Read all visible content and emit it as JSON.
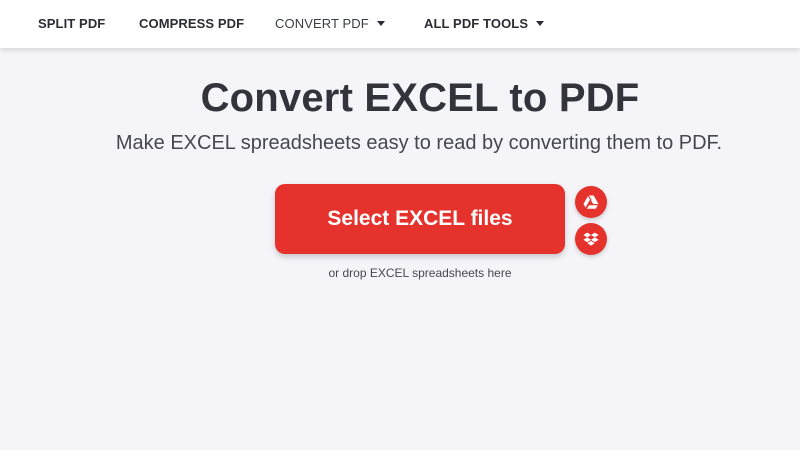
{
  "nav": {
    "items": [
      {
        "label": "SPLIT PDF",
        "dropdown": false
      },
      {
        "label": "COMPRESS PDF",
        "dropdown": false
      },
      {
        "label": "CONVERT PDF",
        "dropdown": true
      },
      {
        "label": "ALL PDF TOOLS",
        "dropdown": true
      }
    ]
  },
  "main": {
    "title": "Convert EXCEL to PDF",
    "subtitle": "Make EXCEL spreadsheets easy to read by converting them to PDF.",
    "select_button_label": "Select EXCEL files",
    "drop_hint": "or drop EXCEL spreadsheets here",
    "cloud_buttons": [
      {
        "icon": "google-drive-icon"
      },
      {
        "icon": "dropbox-icon"
      }
    ]
  },
  "colors": {
    "accent": "#e5322d",
    "background": "#f4f4f9",
    "navbar": "#ffffff",
    "text": "#33333b"
  }
}
